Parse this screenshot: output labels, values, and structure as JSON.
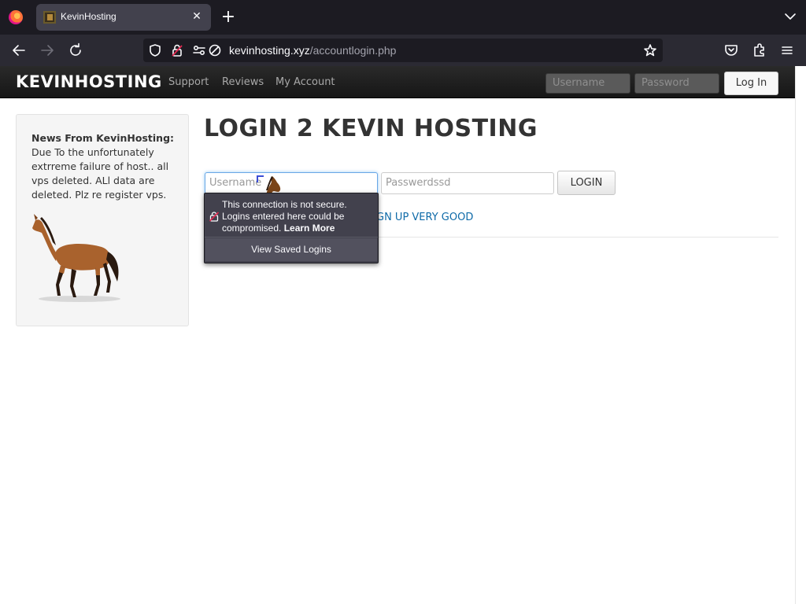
{
  "browser": {
    "tab_title": "KevinHosting",
    "url_domain": "kevinhosting.xyz",
    "url_path": "/accountlogin.php"
  },
  "site": {
    "brand": "KEVINHOSTING",
    "nav_links": [
      "Support",
      "Reviews",
      "My Account"
    ],
    "nav_username_placeholder": "Username",
    "nav_password_placeholder": "Password",
    "nav_login_label": "Log In"
  },
  "sidebar": {
    "news_title": "News From KevinHosting:",
    "news_body": "Due To the unfortunately extrreme failure of host.. all vps deleted. ALl data are deleted. Plz re register vps."
  },
  "main": {
    "title": "LOGIN 2 KEVIN HOSTING",
    "username_placeholder": "Username",
    "password_placeholder": "Passwerdssd",
    "login_label": "LOGIN",
    "signup_link": "GN UP VERY GOOD"
  },
  "popup": {
    "message": "This connection is not secure. Logins entered here could be compromised.",
    "learn_more": "Learn More",
    "saved_logins": "View Saved Logins"
  }
}
